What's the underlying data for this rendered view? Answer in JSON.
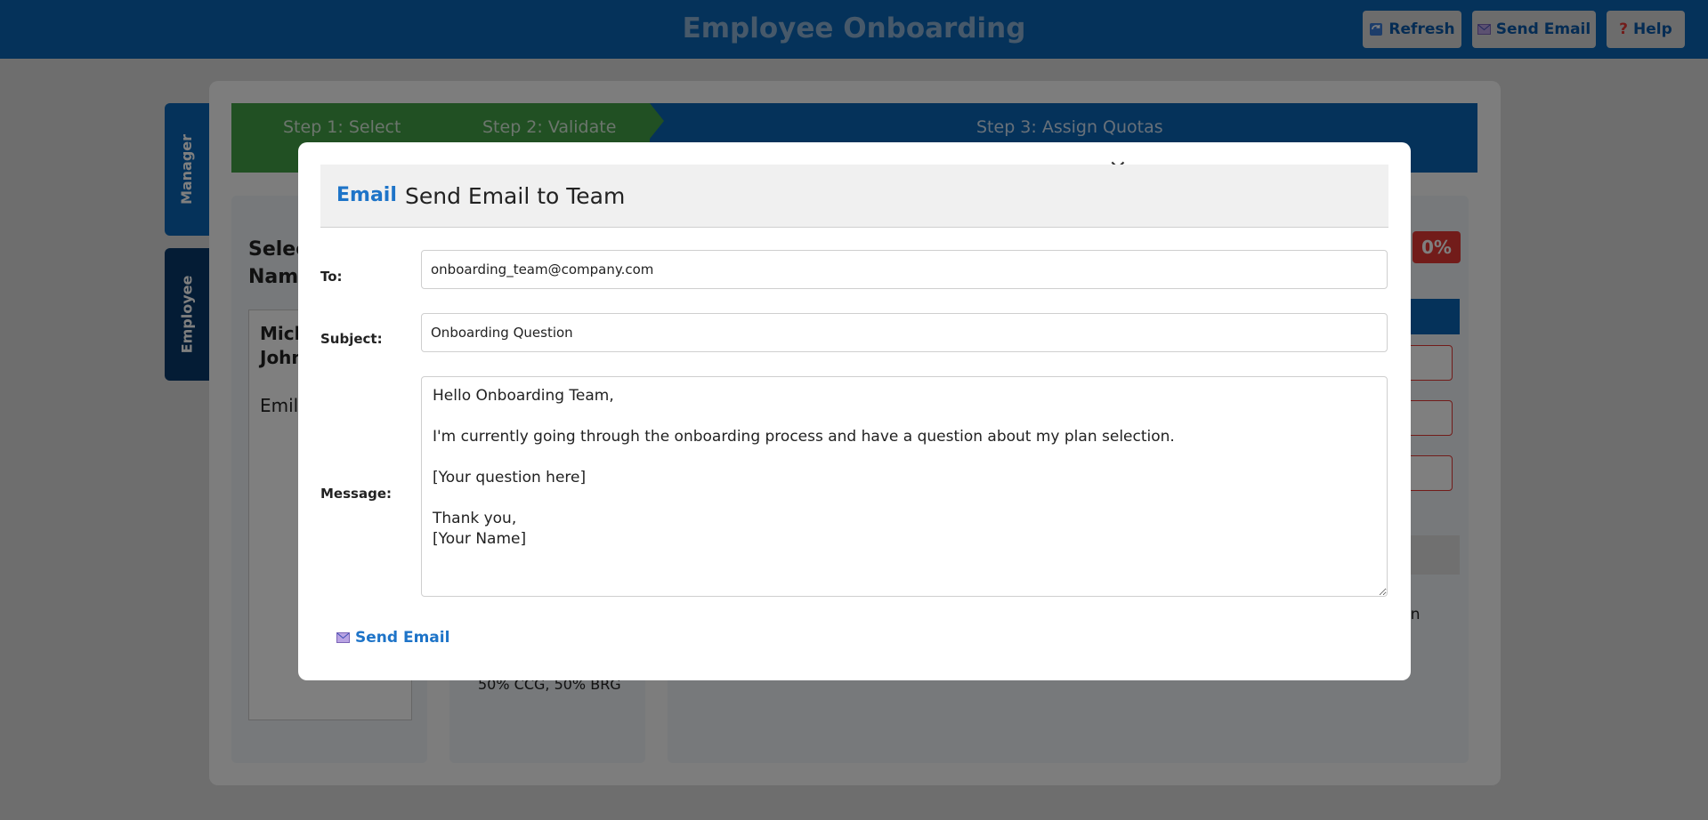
{
  "header": {
    "title": "Employee Onboarding",
    "refresh_label": "Refresh",
    "send_email_label": "Send Email",
    "help_label": "Help"
  },
  "side_tabs": {
    "manager": "Manager",
    "employee": "Employee"
  },
  "steps": [
    "Step 1: Select",
    "Step 2: Validate",
    "Step 3: Assign Quotas"
  ],
  "background": {
    "select_heading_line1": "Selec",
    "select_heading_line2": "Nam",
    "employee_row_1_line1": "Mich",
    "employee_row_1_line2": "John",
    "employee_row_2": "Emily",
    "plan_split": "50% CCG, 50% BRG",
    "progress_badge": "0%",
    "partial_text": "in"
  },
  "modal": {
    "tag": "Email",
    "title": "Send Email to Team",
    "close_symbol": "×",
    "to_label": "To:",
    "to_value": "onboarding_team@company.com",
    "subject_label": "Subject:",
    "subject_value": "Onboarding Question",
    "message_label": "Message:",
    "message_value": "Hello Onboarding Team,\n\nI'm currently going through the onboarding process and have a question about my plan selection.\n\n[Your question here]\n\nThank you,\n[Your Name]",
    "send_label": "Send Email"
  },
  "colors": {
    "primary": "#0b64b4",
    "success": "#43a047",
    "danger": "#e53935",
    "link": "#1e74c8"
  }
}
